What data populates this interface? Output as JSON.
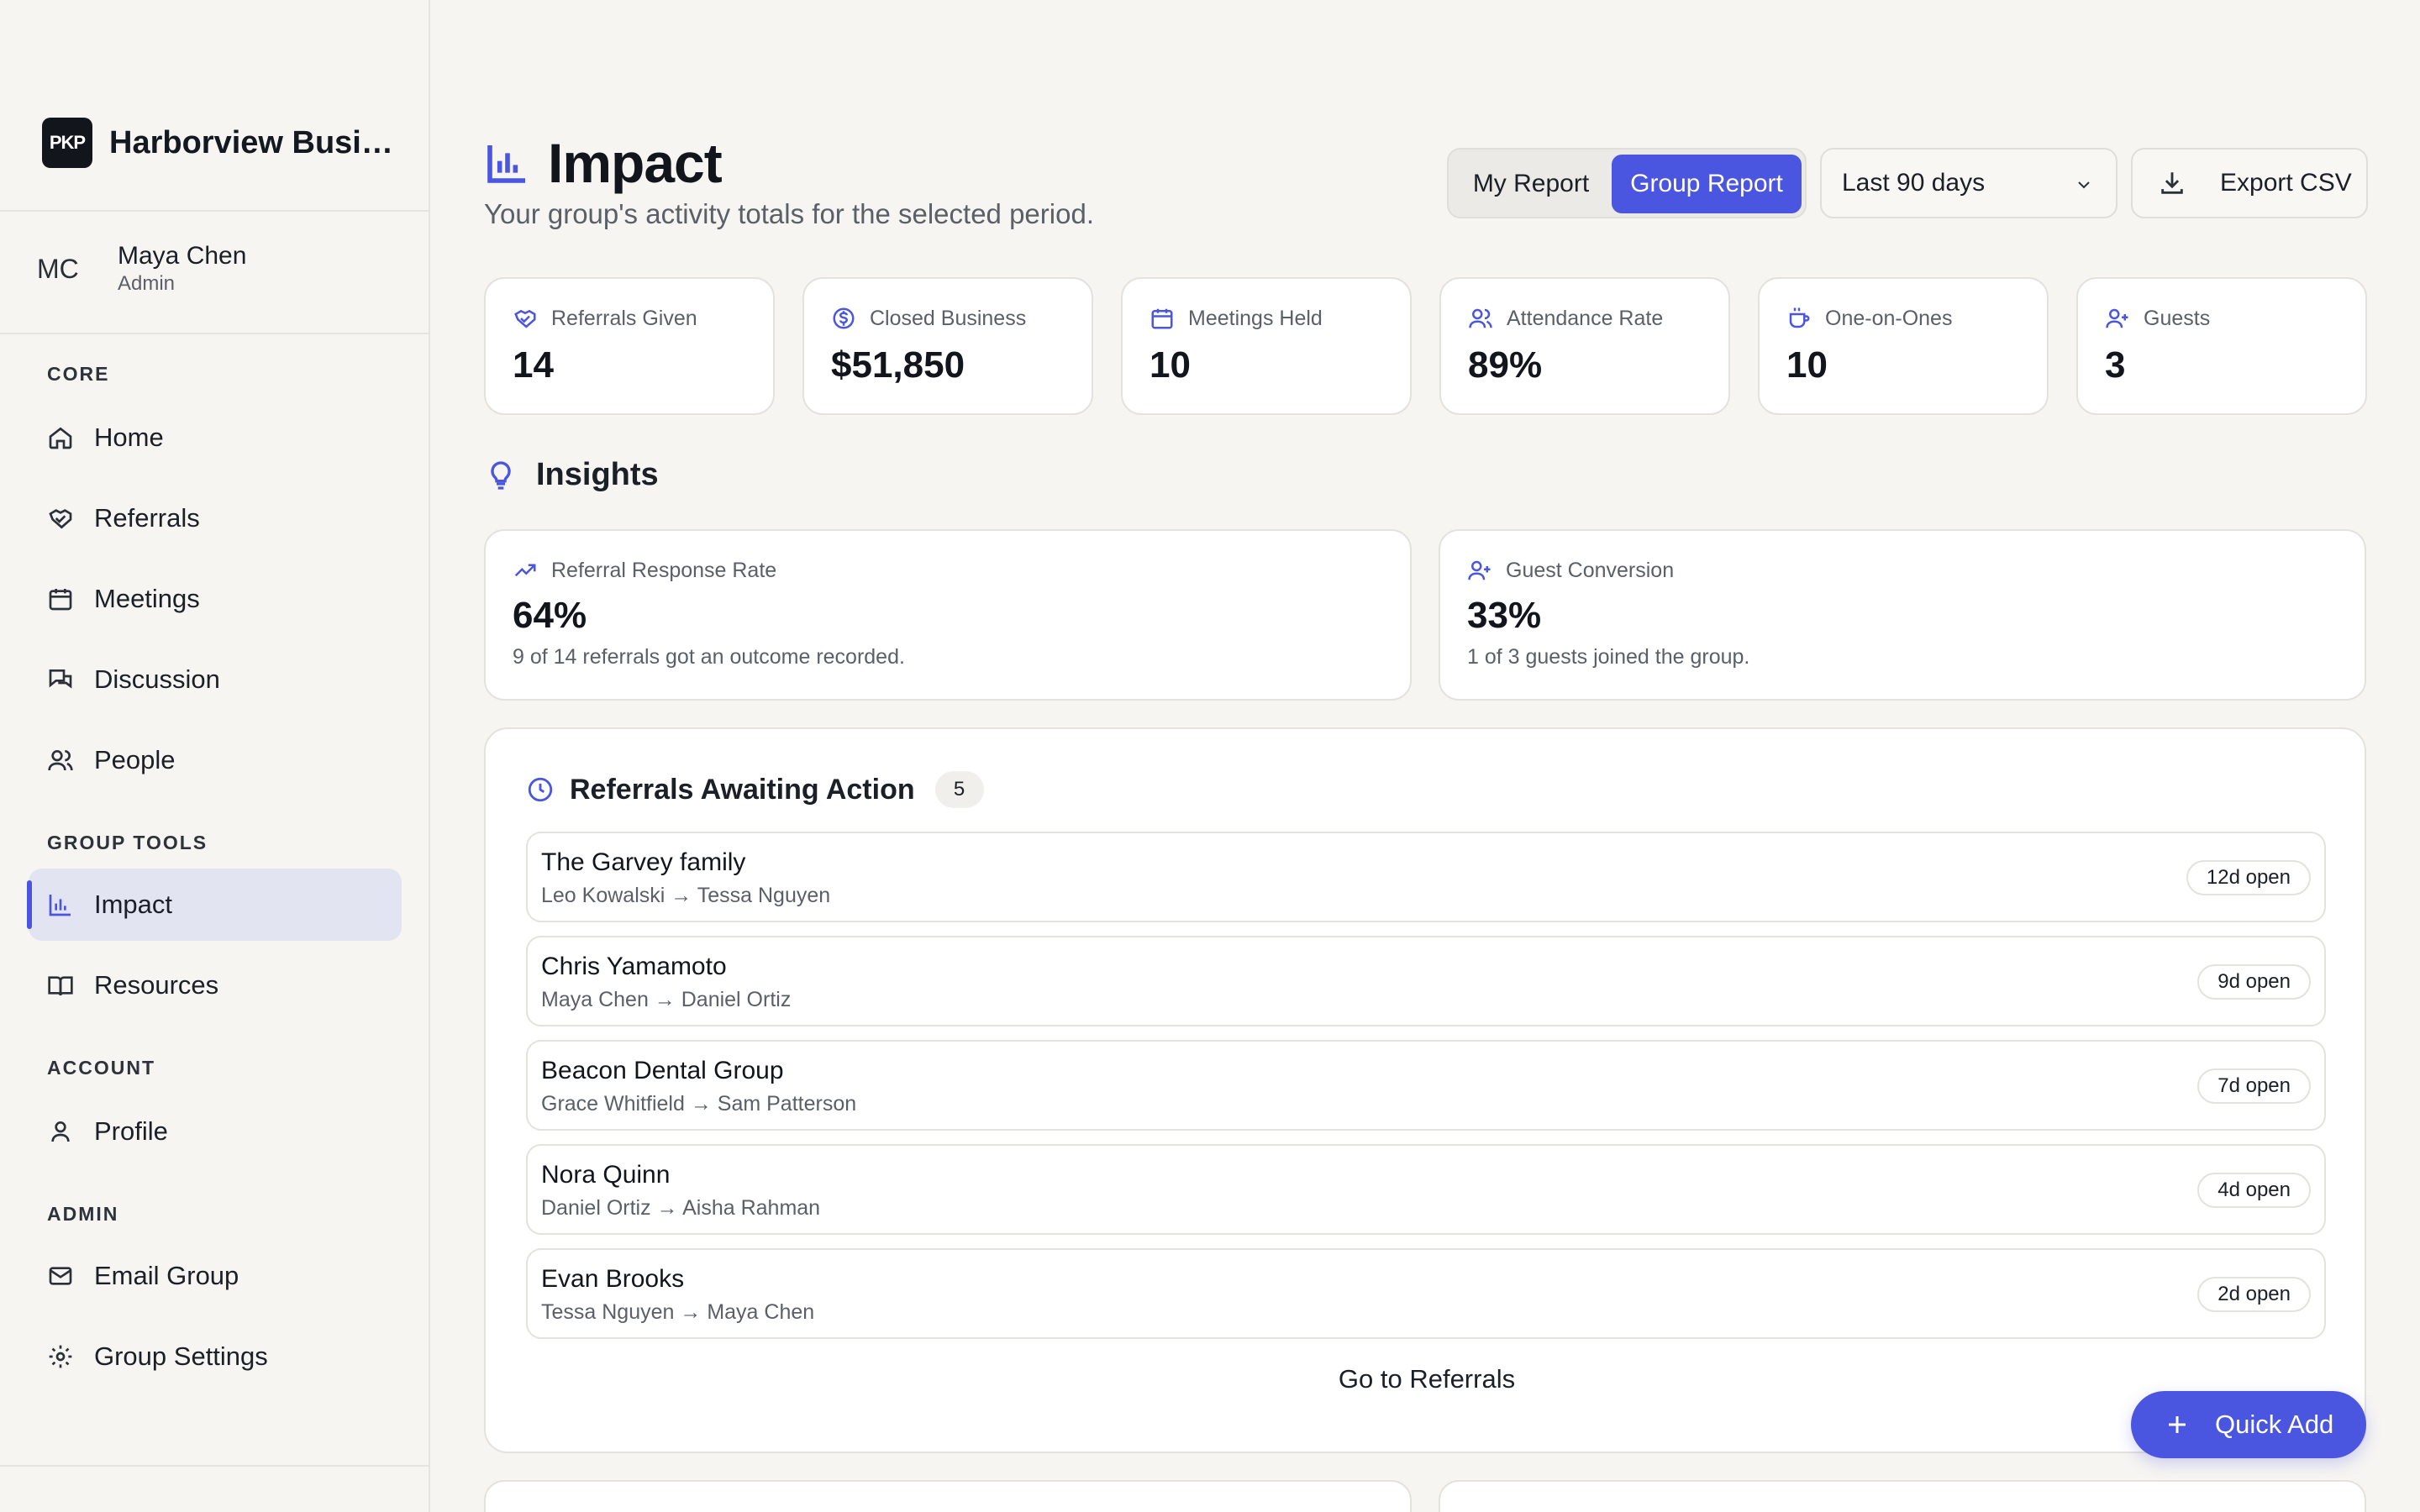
{
  "brand": {
    "logo_text": "PKP",
    "name": "Harborview Busi…"
  },
  "user": {
    "initials": "MC",
    "name": "Maya Chen",
    "role": "Admin"
  },
  "nav": {
    "sections": {
      "core": "CORE",
      "group_tools": "GROUP TOOLS",
      "account": "ACCOUNT",
      "admin": "ADMIN"
    },
    "items": {
      "home": "Home",
      "referrals": "Referrals",
      "meetings": "Meetings",
      "discussion": "Discussion",
      "people": "People",
      "impact": "Impact",
      "resources": "Resources",
      "profile": "Profile",
      "email_group": "Email Group",
      "group_settings": "Group Settings"
    },
    "active": "impact"
  },
  "header": {
    "title": "Impact",
    "subtitle": "Your group's activity totals for the selected period.",
    "toggle": {
      "my": "My Report",
      "group": "Group Report",
      "selected": "group"
    },
    "period": "Last 90 days",
    "export_label": "Export CSV"
  },
  "stats": [
    {
      "label": "Referrals Given",
      "value": "14",
      "icon": "handshake-icon"
    },
    {
      "label": "Closed Business",
      "value": "$51,850",
      "icon": "dollar-icon"
    },
    {
      "label": "Meetings Held",
      "value": "10",
      "icon": "calendar-icon"
    },
    {
      "label": "Attendance Rate",
      "value": "89%",
      "icon": "users-icon"
    },
    {
      "label": "One-on-Ones",
      "value": "10",
      "icon": "coffee-icon"
    },
    {
      "label": "Guests",
      "value": "3",
      "icon": "user-plus-icon"
    }
  ],
  "insights": {
    "title": "Insights",
    "cards": [
      {
        "label": "Referral Response Rate",
        "value": "64%",
        "note": "9 of 14 referrals got an outcome recorded.",
        "icon": "trending-up-icon"
      },
      {
        "label": "Guest Conversion",
        "value": "33%",
        "note": "1 of 3 guests joined the group.",
        "icon": "user-plus-icon"
      }
    ]
  },
  "awaiting": {
    "title": "Referrals Awaiting Action",
    "count": "5",
    "rows": [
      {
        "name": "The Garvey family",
        "path": "Leo Kowalski → Tessa Nguyen",
        "badge": "12d open"
      },
      {
        "name": "Chris Yamamoto",
        "path": "Maya Chen → Daniel Ortiz",
        "badge": "9d open"
      },
      {
        "name": "Beacon Dental Group",
        "path": "Grace Whitfield → Sam Patterson",
        "badge": "7d open"
      },
      {
        "name": "Nora Quinn",
        "path": "Daniel Ortiz → Aisha Rahman",
        "badge": "4d open"
      },
      {
        "name": "Evan Brooks",
        "path": "Tessa Nguyen → Maya Chen",
        "badge": "2d open"
      }
    ],
    "link": "Go to Referrals"
  },
  "quick_add": "Quick Add",
  "colors": {
    "accent": "#4a55e0",
    "background": "#f6f5f2",
    "card": "#ffffff"
  }
}
